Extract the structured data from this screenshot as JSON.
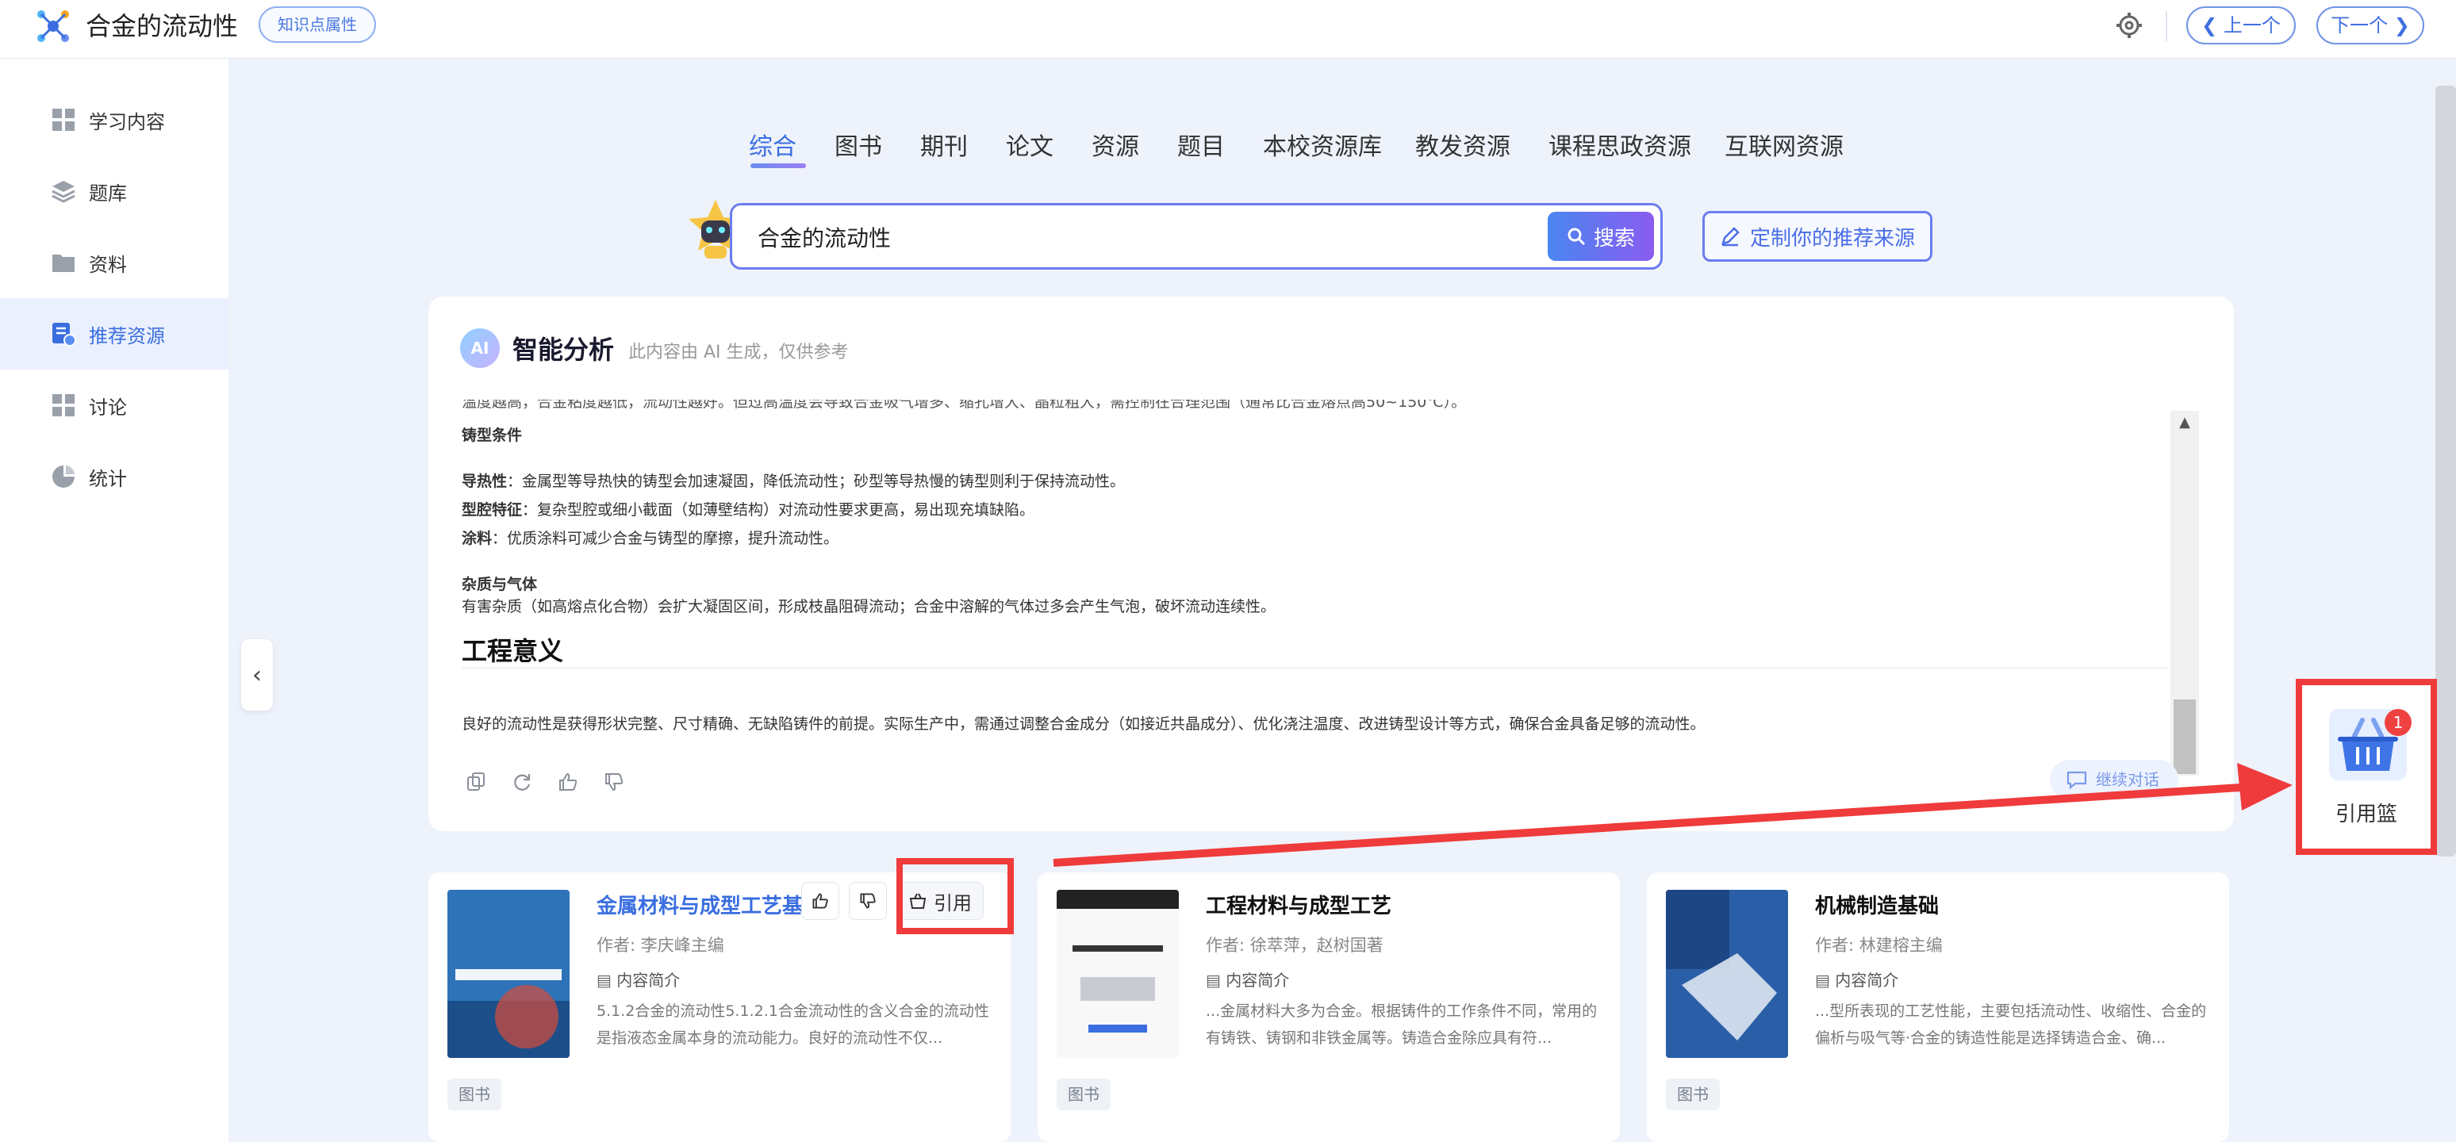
{
  "header": {
    "title": "合金的流动性",
    "badge": "知识点属性",
    "prev": "❮ 上一个",
    "next": "下一个 ❯"
  },
  "sidebar": {
    "items": [
      {
        "label": "学习内容",
        "icon": "grid-icon"
      },
      {
        "label": "题库",
        "icon": "layers-icon"
      },
      {
        "label": "资料",
        "icon": "folder-icon"
      },
      {
        "label": "推荐资源",
        "icon": "recommend-icon",
        "active": true
      },
      {
        "label": "讨论",
        "icon": "grid-icon"
      },
      {
        "label": "统计",
        "icon": "pie-chart-icon"
      }
    ]
  },
  "tabs": [
    "综合",
    "图书",
    "期刊",
    "论文",
    "资源",
    "题目",
    "本校资源库",
    "教发资源",
    "课程思政资源",
    "互联网资源"
  ],
  "search": {
    "value": "合金的流动性",
    "button": "搜索",
    "customize": "定制你的推荐来源"
  },
  "ai": {
    "badge": "AI",
    "title": "智能分析",
    "note": "此内容由 AI 生成，仅供参考",
    "lines": {
      "cut": "温度越高，合金粘度越低，流动性越好。但过高温度会导致合金吸气增多、缩孔增大、晶粒粗大，需控制在合理范围（通常比合金熔点高50~150℃）。",
      "mold_heading": "铸型条件",
      "l1_key": "导热性",
      "l1_text": "：金属型等导热快的铸型会加速凝固，降低流动性；砂型等导热慢的铸型则利于保持流动性。",
      "l2_key": "型腔特征",
      "l2_text": "：复杂型腔或细小截面（如薄壁结构）对流动性要求更高，易出现充填缺陷。",
      "l3_key": "涂料",
      "l3_text": "：优质涂料可减少合金与铸型的摩擦，提升流动性。",
      "impurity_heading": "杂质与气体",
      "impurity_text": "有害杂质（如高熔点化合物）会扩大凝固区间，形成枝晶阻碍流动；合金中溶解的气体过多会产生气泡，破坏流动连续性。",
      "eng_heading": "工程意义",
      "eng_text": "良好的流动性是获得形状完整、尺寸精确、无缺陷铸件的前提。实际生产中，需通过调整合金成分（如接近共晶成分）、优化浇注温度、改进铸型设计等方式，确保合金具备足够的流动性。"
    },
    "continue": "继续对话"
  },
  "cards": [
    {
      "title": "金属材料与成型工艺基",
      "author": "作者: 李庆峰主编",
      "intro_label": "内容简介",
      "intro": "5.1.2合金的流动性5.1.2.1合金流动性的含义合金的流动性是指液态金属本身的流动能力。良好的流动性不仅...",
      "tag": "图书",
      "cite": "引用"
    },
    {
      "title": "工程材料与成型工艺",
      "author": "作者: 徐萃萍，赵树国著",
      "intro_label": "内容简介",
      "intro": "...金属材料大多为合金。根据铸件的工作条件不同，常用的有铸铁、铸钢和非铁金属等。铸造合金除应具有符...",
      "tag": "图书"
    },
    {
      "title": "机械制造基础",
      "author": "作者: 林建榕主编",
      "intro_label": "内容简介",
      "intro": "...型所表现的工艺性能，主要包括流动性、收缩性、合金的偏析与吸气等·合金的铸造性能是选择铸造合金、确...",
      "tag": "图书"
    }
  ],
  "basket": {
    "label": "引用篮",
    "count": "1"
  },
  "colors": {
    "accent": "#3a6ee0",
    "highlight": "#ef3b3b"
  }
}
